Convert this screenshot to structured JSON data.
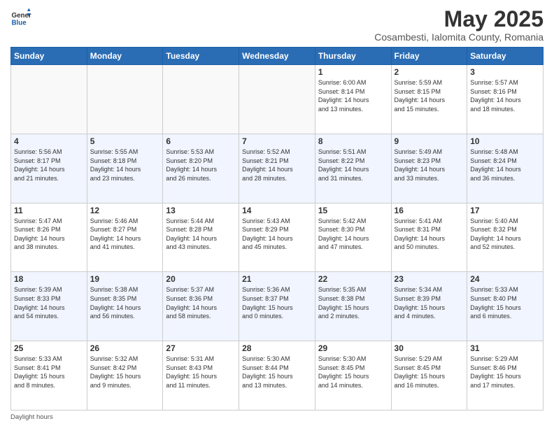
{
  "header": {
    "logo_general": "General",
    "logo_blue": "Blue",
    "month_title": "May 2025",
    "location": "Cosambesti, Ialomita County, Romania"
  },
  "weekdays": [
    "Sunday",
    "Monday",
    "Tuesday",
    "Wednesday",
    "Thursday",
    "Friday",
    "Saturday"
  ],
  "weeks": [
    [
      {
        "day": "",
        "info": ""
      },
      {
        "day": "",
        "info": ""
      },
      {
        "day": "",
        "info": ""
      },
      {
        "day": "",
        "info": ""
      },
      {
        "day": "1",
        "info": "Sunrise: 6:00 AM\nSunset: 8:14 PM\nDaylight: 14 hours\nand 13 minutes."
      },
      {
        "day": "2",
        "info": "Sunrise: 5:59 AM\nSunset: 8:15 PM\nDaylight: 14 hours\nand 15 minutes."
      },
      {
        "day": "3",
        "info": "Sunrise: 5:57 AM\nSunset: 8:16 PM\nDaylight: 14 hours\nand 18 minutes."
      }
    ],
    [
      {
        "day": "4",
        "info": "Sunrise: 5:56 AM\nSunset: 8:17 PM\nDaylight: 14 hours\nand 21 minutes."
      },
      {
        "day": "5",
        "info": "Sunrise: 5:55 AM\nSunset: 8:18 PM\nDaylight: 14 hours\nand 23 minutes."
      },
      {
        "day": "6",
        "info": "Sunrise: 5:53 AM\nSunset: 8:20 PM\nDaylight: 14 hours\nand 26 minutes."
      },
      {
        "day": "7",
        "info": "Sunrise: 5:52 AM\nSunset: 8:21 PM\nDaylight: 14 hours\nand 28 minutes."
      },
      {
        "day": "8",
        "info": "Sunrise: 5:51 AM\nSunset: 8:22 PM\nDaylight: 14 hours\nand 31 minutes."
      },
      {
        "day": "9",
        "info": "Sunrise: 5:49 AM\nSunset: 8:23 PM\nDaylight: 14 hours\nand 33 minutes."
      },
      {
        "day": "10",
        "info": "Sunrise: 5:48 AM\nSunset: 8:24 PM\nDaylight: 14 hours\nand 36 minutes."
      }
    ],
    [
      {
        "day": "11",
        "info": "Sunrise: 5:47 AM\nSunset: 8:26 PM\nDaylight: 14 hours\nand 38 minutes."
      },
      {
        "day": "12",
        "info": "Sunrise: 5:46 AM\nSunset: 8:27 PM\nDaylight: 14 hours\nand 41 minutes."
      },
      {
        "day": "13",
        "info": "Sunrise: 5:44 AM\nSunset: 8:28 PM\nDaylight: 14 hours\nand 43 minutes."
      },
      {
        "day": "14",
        "info": "Sunrise: 5:43 AM\nSunset: 8:29 PM\nDaylight: 14 hours\nand 45 minutes."
      },
      {
        "day": "15",
        "info": "Sunrise: 5:42 AM\nSunset: 8:30 PM\nDaylight: 14 hours\nand 47 minutes."
      },
      {
        "day": "16",
        "info": "Sunrise: 5:41 AM\nSunset: 8:31 PM\nDaylight: 14 hours\nand 50 minutes."
      },
      {
        "day": "17",
        "info": "Sunrise: 5:40 AM\nSunset: 8:32 PM\nDaylight: 14 hours\nand 52 minutes."
      }
    ],
    [
      {
        "day": "18",
        "info": "Sunrise: 5:39 AM\nSunset: 8:33 PM\nDaylight: 14 hours\nand 54 minutes."
      },
      {
        "day": "19",
        "info": "Sunrise: 5:38 AM\nSunset: 8:35 PM\nDaylight: 14 hours\nand 56 minutes."
      },
      {
        "day": "20",
        "info": "Sunrise: 5:37 AM\nSunset: 8:36 PM\nDaylight: 14 hours\nand 58 minutes."
      },
      {
        "day": "21",
        "info": "Sunrise: 5:36 AM\nSunset: 8:37 PM\nDaylight: 15 hours\nand 0 minutes."
      },
      {
        "day": "22",
        "info": "Sunrise: 5:35 AM\nSunset: 8:38 PM\nDaylight: 15 hours\nand 2 minutes."
      },
      {
        "day": "23",
        "info": "Sunrise: 5:34 AM\nSunset: 8:39 PM\nDaylight: 15 hours\nand 4 minutes."
      },
      {
        "day": "24",
        "info": "Sunrise: 5:33 AM\nSunset: 8:40 PM\nDaylight: 15 hours\nand 6 minutes."
      }
    ],
    [
      {
        "day": "25",
        "info": "Sunrise: 5:33 AM\nSunset: 8:41 PM\nDaylight: 15 hours\nand 8 minutes."
      },
      {
        "day": "26",
        "info": "Sunrise: 5:32 AM\nSunset: 8:42 PM\nDaylight: 15 hours\nand 9 minutes."
      },
      {
        "day": "27",
        "info": "Sunrise: 5:31 AM\nSunset: 8:43 PM\nDaylight: 15 hours\nand 11 minutes."
      },
      {
        "day": "28",
        "info": "Sunrise: 5:30 AM\nSunset: 8:44 PM\nDaylight: 15 hours\nand 13 minutes."
      },
      {
        "day": "29",
        "info": "Sunrise: 5:30 AM\nSunset: 8:45 PM\nDaylight: 15 hours\nand 14 minutes."
      },
      {
        "day": "30",
        "info": "Sunrise: 5:29 AM\nSunset: 8:45 PM\nDaylight: 15 hours\nand 16 minutes."
      },
      {
        "day": "31",
        "info": "Sunrise: 5:29 AM\nSunset: 8:46 PM\nDaylight: 15 hours\nand 17 minutes."
      }
    ]
  ],
  "footer": "Daylight hours"
}
